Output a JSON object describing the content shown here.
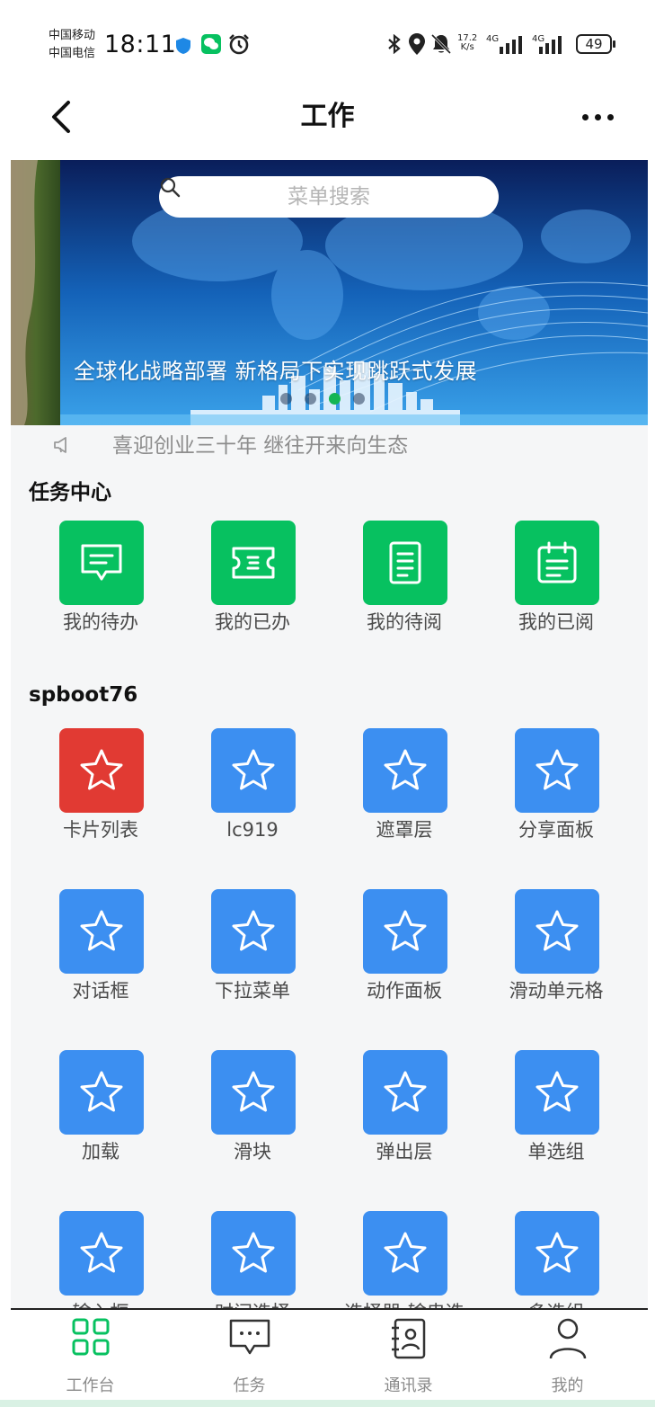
{
  "status_bar": {
    "carrier1": "中国移动",
    "carrier2": "中国电信",
    "time": "18:11",
    "speed_value": "17.2",
    "speed_unit": "K/s",
    "net1": "4G",
    "net2": "4G",
    "battery": "49"
  },
  "nav": {
    "title": "工作"
  },
  "search": {
    "placeholder": "菜单搜索"
  },
  "banner": {
    "caption": "全球化战略部署 新格局下实现跳跃式发展",
    "slide_count": 4,
    "active_slide": 3
  },
  "notice": {
    "text": "喜迎创业三十年 继往开来向生态"
  },
  "task_center": {
    "title": "任务中心",
    "items": [
      {
        "label": "我的待办",
        "icon": "message-icon"
      },
      {
        "label": "我的已办",
        "icon": "ticket-icon"
      },
      {
        "label": "我的待阅",
        "icon": "document-icon"
      },
      {
        "label": "我的已阅",
        "icon": "calendar-icon"
      }
    ]
  },
  "spboot": {
    "title": "spboot76",
    "items": [
      {
        "label": "卡片列表",
        "color": "red"
      },
      {
        "label": "lc919",
        "color": "blue"
      },
      {
        "label": "遮罩层",
        "color": "blue"
      },
      {
        "label": "分享面板",
        "color": "blue"
      },
      {
        "label": "对话框",
        "color": "blue"
      },
      {
        "label": "下拉菜单",
        "color": "blue"
      },
      {
        "label": "动作面板",
        "color": "blue"
      },
      {
        "label": "滑动单元格",
        "color": "blue"
      },
      {
        "label": "加载",
        "color": "blue"
      },
      {
        "label": "滑块",
        "color": "blue"
      },
      {
        "label": "弹出层",
        "color": "blue"
      },
      {
        "label": "单选组",
        "color": "blue"
      },
      {
        "label": "输入框",
        "color": "blue"
      },
      {
        "label": "时间选择",
        "color": "blue"
      },
      {
        "label": "选择器-输串选",
        "color": "blue"
      },
      {
        "label": "多选组",
        "color": "blue"
      }
    ]
  },
  "tabbar": {
    "items": [
      {
        "label": "工作台",
        "icon": "grid-icon",
        "active": true
      },
      {
        "label": "任务",
        "icon": "chat-icon",
        "active": false
      },
      {
        "label": "通讯录",
        "icon": "contacts-icon",
        "active": false
      },
      {
        "label": "我的",
        "icon": "person-icon",
        "active": false
      }
    ]
  },
  "colors": {
    "green": "#07c160",
    "blue": "#3c8ff1",
    "red": "#e13a33",
    "active_dot": "#13b553"
  }
}
